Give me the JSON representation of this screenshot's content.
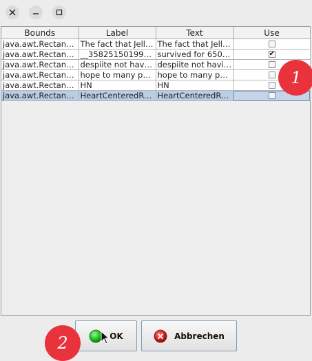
{
  "window": {
    "close_icon": "close-icon",
    "minimize_icon": "minimize-icon",
    "maximize_icon": "maximize-icon"
  },
  "table": {
    "columns": [
      "Bounds",
      "Label",
      "Text",
      "Use"
    ],
    "rows": [
      {
        "bounds": "java.awt.Rectangl...",
        "label": "The fact that Jellyf...",
        "text": "The fact that Jellyf...",
        "use": false
      },
      {
        "bounds": "java.awt.Rectangl...",
        "label": "__358251501994...",
        "text": "survived for 650 ...",
        "use": true
      },
      {
        "bounds": "java.awt.Rectangl...",
        "label": "despiite not havin...",
        "text": "despiite not havin...",
        "use": false
      },
      {
        "bounds": "java.awt.Rectangl...",
        "label": "hope to many peo...",
        "text": "hope to many peo...",
        "use": false
      },
      {
        "bounds": "java.awt.Rectangl...",
        "label": "HN",
        "text": "HN",
        "use": false
      },
      {
        "bounds": "java.awt.Rectangl...",
        "label": "HeartCenteredRe...",
        "text": "HeartCenteredRe...",
        "use": false
      }
    ],
    "selected_row": 5,
    "checked_glyph": "✔"
  },
  "buttons": {
    "ok_label": "OK",
    "cancel_label": "Abbrechen"
  },
  "badges": {
    "one": "1",
    "two": "2"
  },
  "colors": {
    "badge": "#e8323c",
    "selection": "#b9cde5",
    "ok_icon": "#22c322",
    "cancel_icon": "#d62020"
  }
}
